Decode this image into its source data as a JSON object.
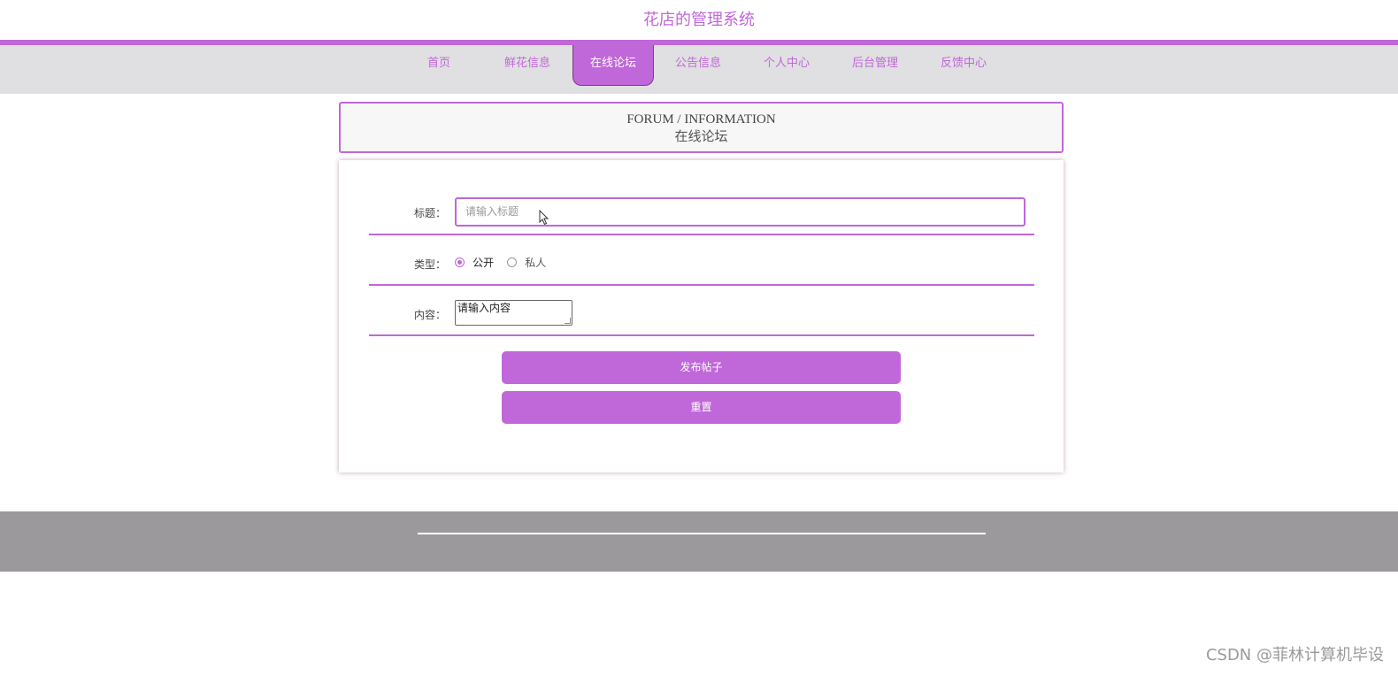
{
  "site": {
    "title": "花店的管理系统"
  },
  "nav": {
    "items": [
      {
        "label": "首页"
      },
      {
        "label": "鲜花信息"
      },
      {
        "label": "在线论坛"
      },
      {
        "label": "公告信息"
      },
      {
        "label": "个人中心"
      },
      {
        "label": "后台管理"
      },
      {
        "label": "反馈中心"
      }
    ],
    "active": "在线论坛"
  },
  "header": {
    "title_en": "FORUM / INFORMATION",
    "title_cn": "在线论坛"
  },
  "form": {
    "title_label": "标题：",
    "title_placeholder": "请输入标题",
    "type_label": "类型：",
    "type_options": [
      "公开",
      "私人"
    ],
    "type_selected": "公开",
    "content_label": "内容：",
    "content_placeholder": "请输入内容",
    "submit_label": "发布帖子",
    "reset_label": "重置"
  },
  "watermark": "CSDN @菲林计算机毕设",
  "colors": {
    "accent": "#c067d9",
    "nav_bg": "#e0dfe2",
    "footer_bg": "#9b999c"
  }
}
